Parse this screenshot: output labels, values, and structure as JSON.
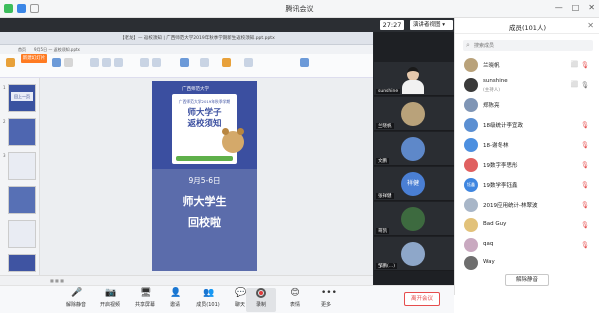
{
  "window": {
    "title": "腾讯会议"
  },
  "meeting": {
    "timer": "27:27",
    "view_mode": "演讲者视图"
  },
  "shared_screen": {
    "browser_url": "【老龙】— 返校须知 | 广西师范大学2019年秋季学期新生返校须知.ppt.pptx",
    "office_tabs": [
      "首页",
      "9月5日 — 返校须知.pptx",
      "●"
    ],
    "ribbon_primary": "新建幻灯片",
    "slide_numbers": [
      "1",
      "2",
      "3"
    ],
    "thumb_captions": [
      "回上一页",
      "",
      ""
    ],
    "slide": {
      "logo": "广西师范大学",
      "subtitle": "广西师范大学2019年秋季学期",
      "title": "师大学子\n返校须知",
      "date": "9月5-6日",
      "line1": "师大学生",
      "line2": "回校啦"
    }
  },
  "videos": [
    {
      "name": "",
      "type": "person"
    },
    {
      "name": "sunshine",
      "type": "person"
    },
    {
      "name": "兰晓帆",
      "type": "avatar",
      "color": "#b9a27a"
    },
    {
      "name": "文鹏",
      "type": "avatar",
      "color": "#5e88c9"
    },
    {
      "name": "张祥健",
      "type": "text",
      "text": "祥健",
      "color": "#4a7fd4"
    },
    {
      "name": "哥凯",
      "type": "avatar",
      "color": "#3d6a3f"
    },
    {
      "name": "邹鹏(…)",
      "type": "avatar",
      "color": "#8ea7c9"
    }
  ],
  "toolbar": {
    "items": [
      {
        "label": "解除静音",
        "icon": "🎤"
      },
      {
        "label": "开启视频",
        "icon": "📷"
      },
      {
        "label": "共享屏幕",
        "icon": "🖥"
      },
      {
        "label": "邀请",
        "icon": "👤"
      },
      {
        "label": "成员(101)",
        "icon": "👥"
      },
      {
        "label": "聊天",
        "icon": "💬"
      },
      {
        "label": "录制",
        "icon": ""
      },
      {
        "label": "表情",
        "icon": "😊"
      },
      {
        "label": "更多",
        "icon": "…"
      }
    ],
    "leave": "离开会议"
  },
  "members": {
    "title": "成员(101人)",
    "search_placeholder": "搜索成员",
    "list": [
      {
        "name": "兰晓帆",
        "sub": "",
        "avatar_color": "#b9a27a",
        "avatar_text": ""
      },
      {
        "name": "sunshine",
        "sub": "(主持人)",
        "avatar_color": "#3a3a3a",
        "avatar_text": ""
      },
      {
        "name": "郑陈亮",
        "sub": "",
        "avatar_color": "#7f95b5",
        "avatar_text": ""
      },
      {
        "name": "18级统计李宜政",
        "sub": "",
        "avatar_color": "#5b8fd2",
        "avatar_text": ""
      },
      {
        "name": "18-谢冬林",
        "sub": "",
        "avatar_color": "#4c8fe0",
        "avatar_text": ""
      },
      {
        "name": "19数字李思彤",
        "sub": "",
        "avatar_color": "#e06060",
        "avatar_text": ""
      },
      {
        "name": "19数学李钰鑫",
        "sub": "",
        "avatar_color": "#3f86e0",
        "avatar_text": "钰鑫"
      },
      {
        "name": "2019应用统计-林翠波",
        "sub": "",
        "avatar_color": "#a8b6c8",
        "avatar_text": ""
      },
      {
        "name": "Bad Guy",
        "sub": "",
        "avatar_color": "#e2c27a",
        "avatar_text": ""
      },
      {
        "name": "qaq",
        "sub": "",
        "avatar_color": "#c9a9c0",
        "avatar_text": ""
      },
      {
        "name": "Way",
        "sub": "",
        "avatar_color": "#6e6e6e",
        "avatar_text": ""
      }
    ],
    "mute_all": "解除静音"
  }
}
